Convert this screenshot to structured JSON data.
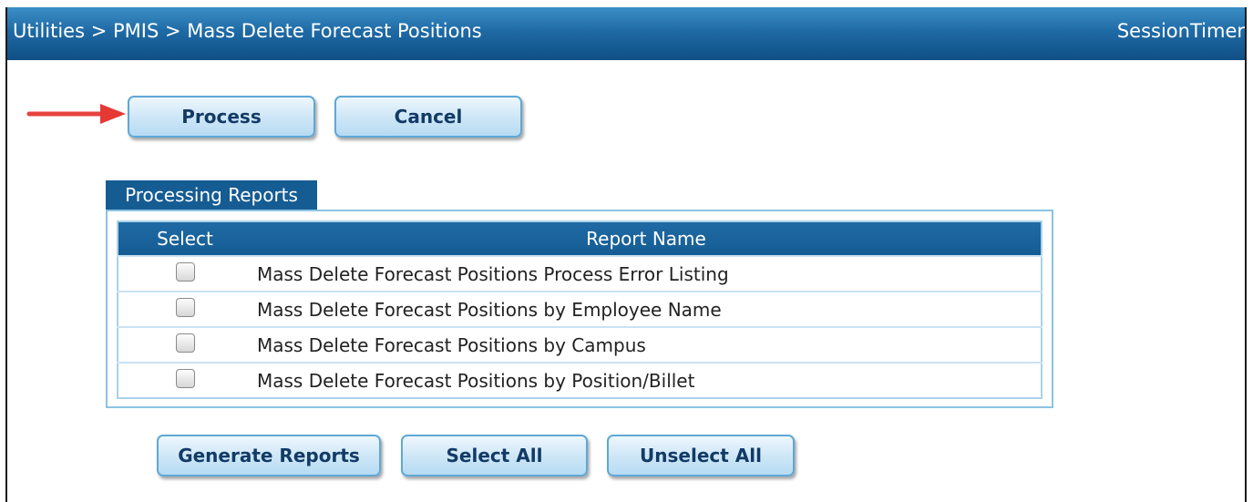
{
  "header": {
    "breadcrumb": "Utilities > PMIS > Mass Delete Forecast Positions",
    "session_timer": "SessionTimer"
  },
  "actions": {
    "process_label": "Process",
    "cancel_label": "Cancel"
  },
  "reports": {
    "tab_label": "Processing Reports",
    "columns": [
      "Select",
      "Report Name"
    ],
    "rows": [
      {
        "checked": false,
        "name": "Mass Delete Forecast Positions Process Error Listing"
      },
      {
        "checked": false,
        "name": "Mass Delete Forecast Positions by Employee Name"
      },
      {
        "checked": false,
        "name": "Mass Delete Forecast Positions by Campus"
      },
      {
        "checked": false,
        "name": "Mass Delete Forecast Positions by Position/Billet"
      }
    ]
  },
  "footer_actions": {
    "generate_label": "Generate Reports",
    "select_all_label": "Select All",
    "unselect_all_label": "Unselect All"
  },
  "colors": {
    "header_bg": "#1f6aa5",
    "button_text": "#123a66",
    "arrow": "#e53935"
  }
}
